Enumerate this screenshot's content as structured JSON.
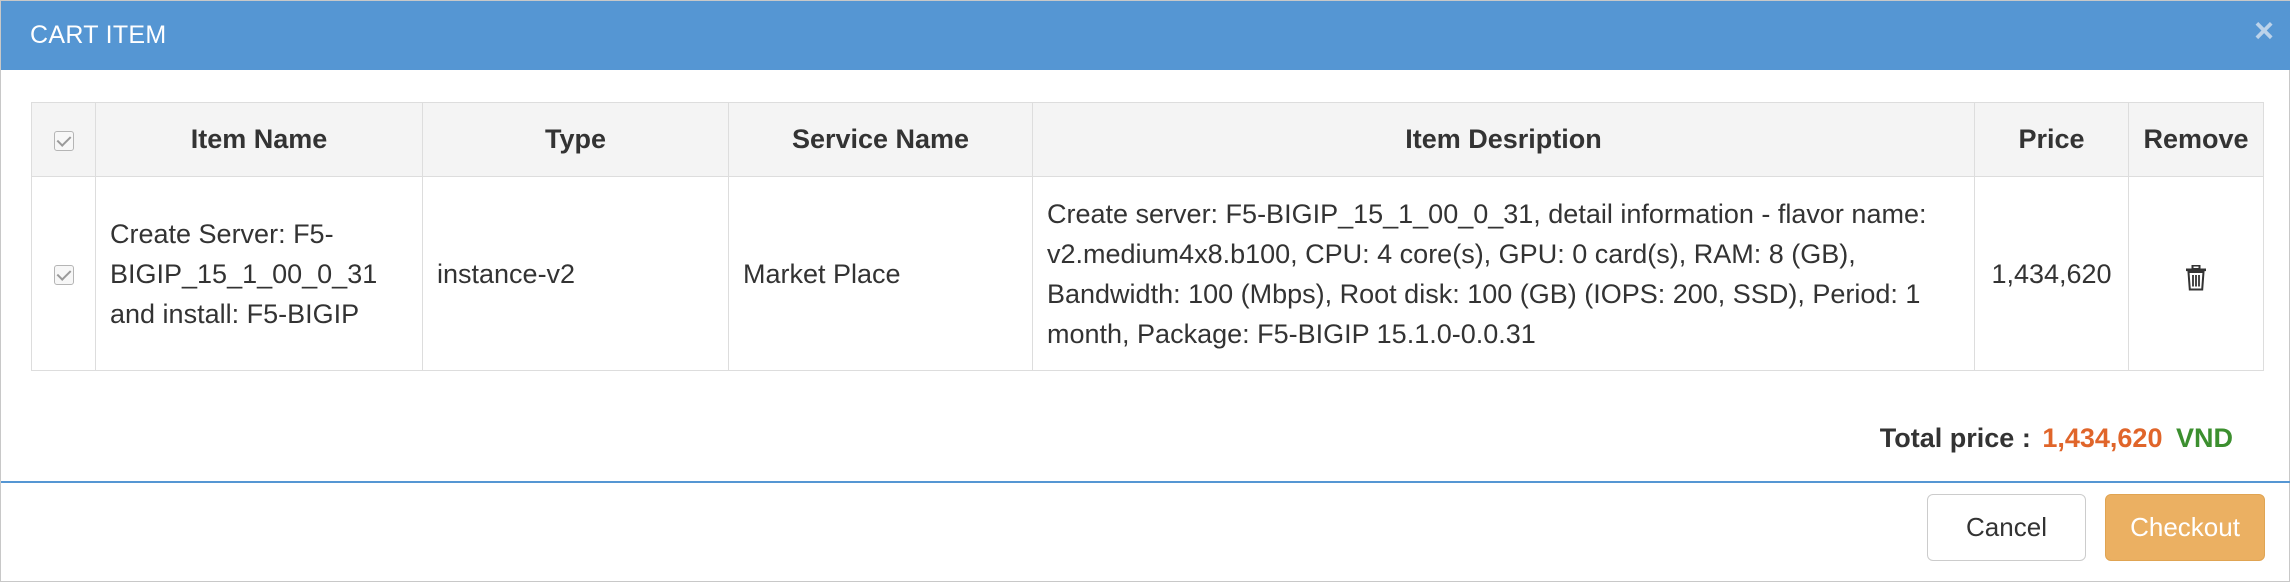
{
  "modal": {
    "title": "CART ITEM",
    "close_symbol": "×"
  },
  "table": {
    "headers": {
      "item_name": "Item Name",
      "type": "Type",
      "service_name": "Service Name",
      "item_description": "Item Desription",
      "price": "Price",
      "remove": "Remove"
    },
    "rows": [
      {
        "checked": true,
        "item_name": "Create Server: F5-BIGIP_15_1_00_0_31 and install: F5-BIGIP",
        "type": "instance-v2",
        "service_name": "Market Place",
        "item_description": "Create server: F5-BIGIP_15_1_00_0_31, detail information - flavor name: v2.medium4x8.b100, CPU: 4 core(s), GPU: 0 card(s), RAM: 8 (GB), Bandwidth: 100 (Mbps), Root disk: 100 (GB) (IOPS: 200, SSD), Period: 1 month, Package: F5-BIGIP 15.1.0-0.0.31",
        "price": "1,434,620",
        "remove_icon": "trash-icon"
      }
    ]
  },
  "total": {
    "label": "Total price :",
    "value": "1,434,620",
    "currency": "VND"
  },
  "footer": {
    "cancel_label": "Cancel",
    "checkout_label": "Checkout"
  },
  "colors": {
    "header_bg": "#5596d3",
    "price": "#e0652a",
    "currency": "#3c8f2f",
    "checkout_bg": "#ebb062"
  }
}
